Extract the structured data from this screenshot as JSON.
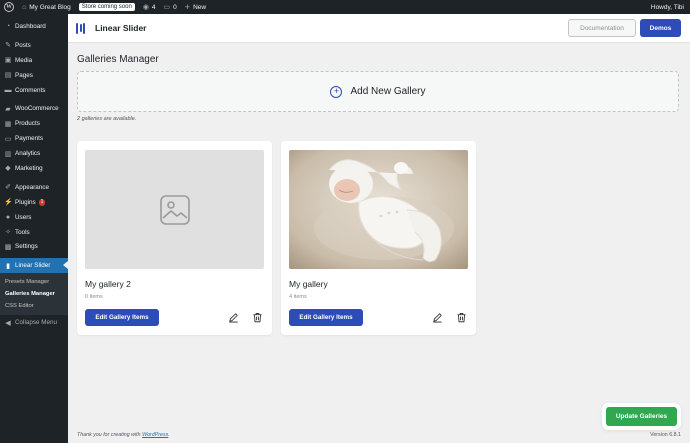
{
  "admin_bar": {
    "site_name": "My Great Blog",
    "store_badge": "Store coming soon",
    "views_count": "4",
    "comments_count": "0",
    "new_label": "New",
    "greeting": "Howdy, Tibi"
  },
  "sidebar": {
    "items": [
      {
        "label": "Dashboard",
        "icon": "dashboard-icon"
      },
      {
        "label": "Posts",
        "icon": "pin-icon"
      },
      {
        "label": "Media",
        "icon": "media-icon"
      },
      {
        "label": "Pages",
        "icon": "pages-icon"
      },
      {
        "label": "Comments",
        "icon": "comments-icon"
      },
      {
        "label": "WooCommerce",
        "icon": "woo-icon"
      },
      {
        "label": "Products",
        "icon": "products-icon"
      },
      {
        "label": "Payments",
        "icon": "payments-icon"
      },
      {
        "label": "Analytics",
        "icon": "analytics-icon"
      },
      {
        "label": "Marketing",
        "icon": "marketing-icon"
      },
      {
        "label": "Appearance",
        "icon": "brush-icon"
      },
      {
        "label": "Plugins",
        "icon": "plug-icon",
        "badge": "1"
      },
      {
        "label": "Users",
        "icon": "users-icon"
      },
      {
        "label": "Tools",
        "icon": "wrench-icon"
      },
      {
        "label": "Settings",
        "icon": "settings-icon"
      },
      {
        "label": "Linear Slider",
        "icon": "slider-icon"
      }
    ],
    "submenu": [
      "Presets Manager",
      "Galleries Manager",
      "CSS Editor"
    ],
    "collapse_label": "Collapse Menu"
  },
  "header": {
    "brand_name": "Linear Slider",
    "documentation_label": "Documentation",
    "demos_label": "Demos",
    "brand_color": "#2d4cb8"
  },
  "main": {
    "title": "Galleries Manager",
    "add_new_label": "Add New Gallery",
    "count_note": "2 galleries are available.",
    "galleries": [
      {
        "title": "My gallery 2",
        "count": "0 items",
        "edit_label": "Edit Gallery Items",
        "has_image": false
      },
      {
        "title": "My gallery",
        "count": "4 items",
        "edit_label": "Edit Gallery Items",
        "has_image": true
      }
    ],
    "update_label": "Update Galleries",
    "update_color": "#2fa84f"
  },
  "footer": {
    "thanks_prefix": "Thank you for creating with ",
    "thanks_link": "WordPress",
    "thanks_suffix": ".",
    "version": "Version 6.8.1"
  }
}
